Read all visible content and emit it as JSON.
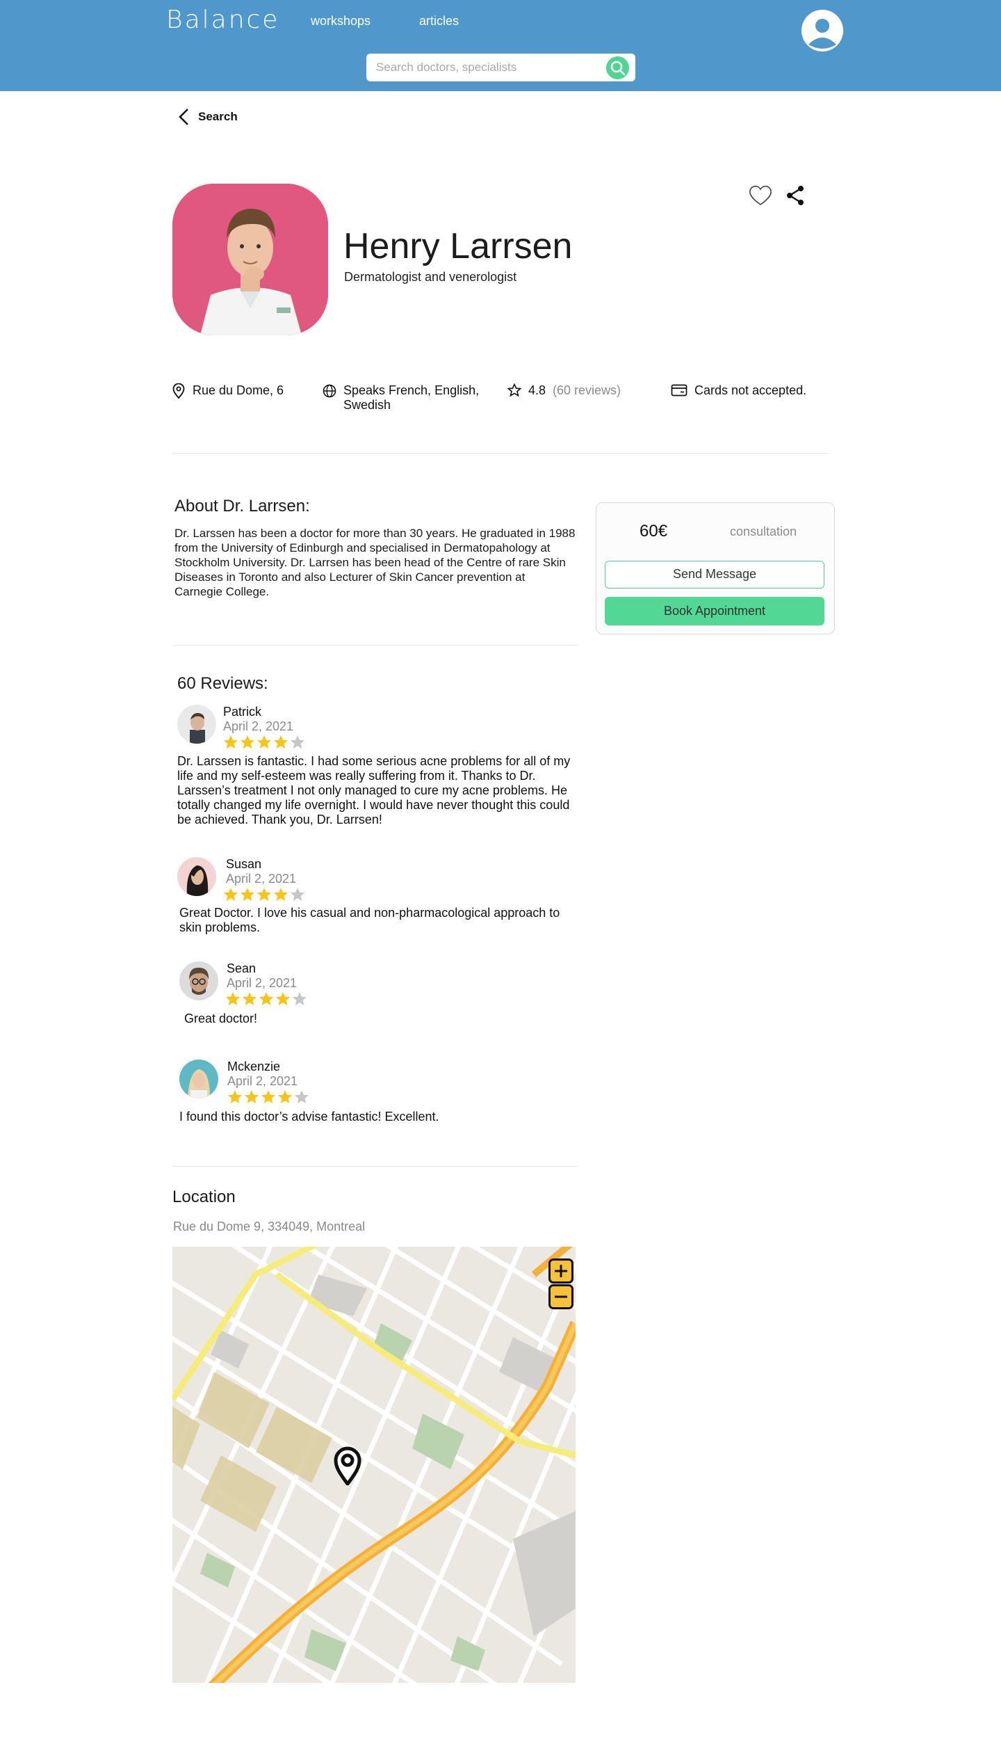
{
  "header": {
    "logo": "Balance",
    "nav": {
      "workshops": "workshops",
      "articles": "articles"
    },
    "search_placeholder": "Search doctors, specialists",
    "colors": {
      "bar": "#5098cc",
      "accent": "#4fd494"
    }
  },
  "back": {
    "label": "Search"
  },
  "doctor": {
    "name": "Henry Larrsen",
    "specialty": "Dermatologist and venerologist",
    "address": "Rue du Dome, 6",
    "languages": "Speaks French, English, Swedish",
    "rating": "4.8",
    "reviews_count_label": "(60 reviews)",
    "cards": "Cards not accepted."
  },
  "about": {
    "title": "About Dr. Larrsen:",
    "text": "Dr. Larssen has been a doctor for more than 30 years. He graduated in 1988 from the University of Edinburgh and specialised in Dermatopahology at Stockholm University. Dr. Larrsen has been head of the Centre of rare Skin Diseases in Toronto and also Lecturer of Skin Cancer prevention at Carnegie College."
  },
  "booking": {
    "price": "60€",
    "price_label": "consultation",
    "send_message": "Send Message",
    "book": "Book Appointment"
  },
  "reviews": {
    "title": "60 Reviews:",
    "items": [
      {
        "name": "Patrick",
        "date": "April 2, 2021",
        "stars": 4,
        "text": "Dr. Larssen is fantastic. I had some serious acne problems for all of my life and my self-esteem was really suffering from it. Thanks to Dr. Larssen’s treatment I not only managed to cure my acne problems. He totally changed my life overnight. I would have never thought this could be achieved. Thank you, Dr. Larrsen!"
      },
      {
        "name": "Susan",
        "date": "April 2, 2021",
        "stars": 4,
        "text": "Great Doctor. I love his casual and non-pharmacological approach to skin problems."
      },
      {
        "name": "Sean",
        "date": "April 2, 2021",
        "stars": 4,
        "text": "Great doctor!"
      },
      {
        "name": "Mckenzie",
        "date": "April 2, 2021",
        "stars": 4,
        "text": "I found this doctor’s advise fantastic! Excellent."
      }
    ]
  },
  "location": {
    "title": "Location",
    "address": "Rue du Dome 9, 334049, Montreal"
  }
}
